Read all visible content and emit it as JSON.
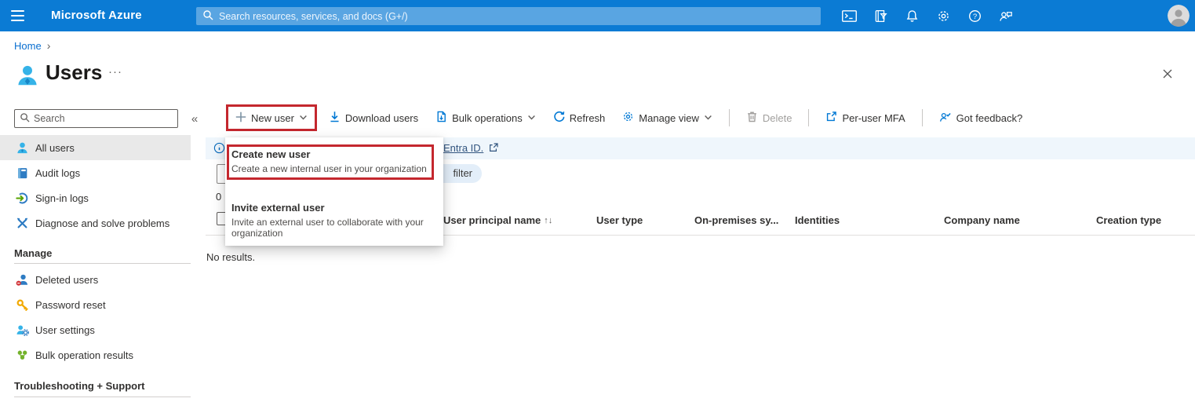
{
  "topbar": {
    "brand": "Microsoft Azure",
    "search_placeholder": "Search resources, services, and docs (G+/)"
  },
  "breadcrumb": {
    "home": "Home",
    "chevron": "›"
  },
  "page": {
    "title": "Users",
    "more_glyph": "···"
  },
  "sidebar": {
    "search_placeholder": "Search",
    "collapse_glyph": "«",
    "items": [
      {
        "label": "All users",
        "selected": true
      },
      {
        "label": "Audit logs",
        "selected": false
      },
      {
        "label": "Sign-in logs",
        "selected": false
      },
      {
        "label": "Diagnose and solve problems",
        "selected": false
      }
    ],
    "manage_header": "Manage",
    "manage_items": [
      {
        "label": "Deleted users"
      },
      {
        "label": "Password reset"
      },
      {
        "label": "User settings"
      },
      {
        "label": "Bulk operation results"
      }
    ],
    "support_header": "Troubleshooting + Support"
  },
  "toolbar": {
    "new_user": "New user",
    "download_users": "Download users",
    "bulk_operations": "Bulk operations",
    "refresh": "Refresh",
    "manage_view": "Manage view",
    "delete": "Delete",
    "per_user_mfa": "Per-user MFA",
    "got_feedback": "Got feedback?"
  },
  "banner": {
    "link_text": "Entra ID."
  },
  "filters": {
    "pill_text": "filter"
  },
  "dropdown": {
    "items": [
      {
        "title": "Create new user",
        "description": "Create a new internal user in your organization",
        "highlighted": true
      },
      {
        "title": "Invite external user",
        "description": "Invite an external user to collaborate with your organization",
        "highlighted": false
      }
    ]
  },
  "table": {
    "sort_glyph": "↑↓",
    "headers": [
      {
        "label": "User principal name"
      },
      {
        "label": "User type"
      },
      {
        "label": "On-premises sy..."
      },
      {
        "label": "Identities"
      },
      {
        "label": "Company name"
      },
      {
        "label": "Creation type"
      }
    ],
    "partial_count": "0",
    "empty_text": "No results."
  },
  "colors": {
    "accent": "#0078d4",
    "highlight_red": "#c4272e",
    "banner_bg": "#eff6fc",
    "person_cyan": "#35b3e8"
  }
}
